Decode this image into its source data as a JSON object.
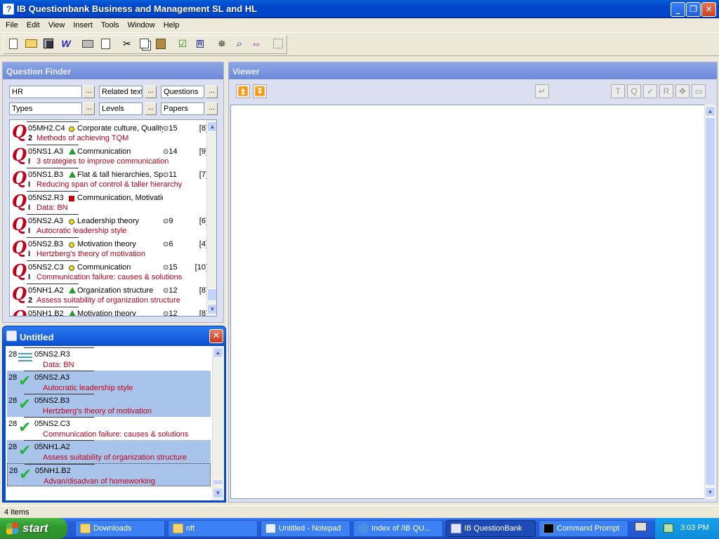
{
  "window": {
    "title": "IB Questionbank Business and Management SL and HL"
  },
  "menu": [
    "File",
    "Edit",
    "View",
    "Insert",
    "Tools",
    "Window",
    "Help"
  ],
  "toolbar": {
    "icons": [
      "new-document-icon",
      "open-folder-icon",
      "save-icon",
      "word-export-icon",
      "print-icon",
      "print-preview-icon",
      "cut-icon",
      "copy-icon",
      "paste-icon",
      "check-icon",
      "reference-icon",
      "binoculars-icon",
      "zoom-search-icon",
      "navigate-arrows-icon",
      "disabled-frame-icon"
    ]
  },
  "finder": {
    "title": "Question Finder",
    "filters": {
      "subject": "HR",
      "related": "Related text",
      "questions": "Questions",
      "types": "Types",
      "levels": "Levels",
      "papers": "Papers",
      "browse": "..."
    },
    "rows": [
      {
        "code": "05MH2.C4",
        "shape": "circle",
        "topic": "Corporate culture, Quality",
        "time": "15",
        "marks": "[8]",
        "level": "2",
        "desc": "Methods of achieving TQM"
      },
      {
        "code": "05NS1.A3",
        "shape": "triangle",
        "topic": "Communication",
        "time": "14",
        "marks": "[9]",
        "level": "I",
        "desc": "3 strategies to improve communication"
      },
      {
        "code": "05NS1.B3",
        "shape": "triangle",
        "topic": "Flat & tall hierarchies, Spa",
        "time": "11",
        "marks": "[7]",
        "level": "I",
        "desc": "Reducing span of control & taller hierarchy"
      },
      {
        "code": "05NS2.R3",
        "shape": "square",
        "topic": "Communication, Motivation theory, Lea",
        "time": "",
        "marks": "",
        "level": "I",
        "desc": "Data: BN"
      },
      {
        "code": "05NS2.A3",
        "shape": "circle",
        "topic": "Leadership theory",
        "time": "9",
        "marks": "[6]",
        "level": "I",
        "desc": "Autocratic leadership style"
      },
      {
        "code": "05NS2.B3",
        "shape": "circle",
        "topic": "Motivation theory",
        "time": "6",
        "marks": "[4]",
        "level": "I",
        "desc": "Hertzberg's theory of motivation"
      },
      {
        "code": "05NS2.C3",
        "shape": "circle",
        "topic": "Communication",
        "time": "15",
        "marks": "[10]",
        "level": "I",
        "desc": "Communication failure: causes & solutions"
      },
      {
        "code": "05NH1.A2",
        "shape": "triangle",
        "topic": "Organization structure",
        "time": "12",
        "marks": "[8]",
        "level": "2",
        "desc": "Assess suitability of organization structure"
      },
      {
        "code": "05NH1.B2",
        "shape": "triangle",
        "topic": "Motivation theory",
        "time": "12",
        "marks": "[8]",
        "level": "",
        "desc": ""
      }
    ]
  },
  "untitled": {
    "title": "Untitled",
    "rows": [
      {
        "num": "28",
        "code": "05NS2.R3",
        "desc": "Data: BN",
        "icon": "lines",
        "selected": false
      },
      {
        "num": "28",
        "code": "05NS2.A3",
        "desc": "Autocratic leadership style",
        "icon": "check",
        "selected": true
      },
      {
        "num": "28",
        "code": "05NS2.B3",
        "desc": "Hertzberg's theory of motivation",
        "icon": "check",
        "selected": true
      },
      {
        "num": "28",
        "code": "05NS2.C3",
        "desc": "Communication failure: causes & solutions",
        "icon": "check",
        "selected": false
      },
      {
        "num": "28",
        "code": "05NH1.A2",
        "desc": "Assess suitability of organization structure",
        "icon": "check",
        "selected": true
      },
      {
        "num": "28",
        "code": "05NH1.B2",
        "desc": "Advan/disadvan of homeworking",
        "icon": "check",
        "selected": true
      }
    ]
  },
  "viewer": {
    "title": "Viewer"
  },
  "status": {
    "text": "4 items"
  },
  "taskbar": {
    "start": "start",
    "tasks": [
      "Downloads",
      "nft",
      "Untitled - Notepad",
      "Index of /IB QU...",
      "IB QuestionBank",
      "Command Prompt"
    ],
    "clock": "3:03 PM"
  }
}
